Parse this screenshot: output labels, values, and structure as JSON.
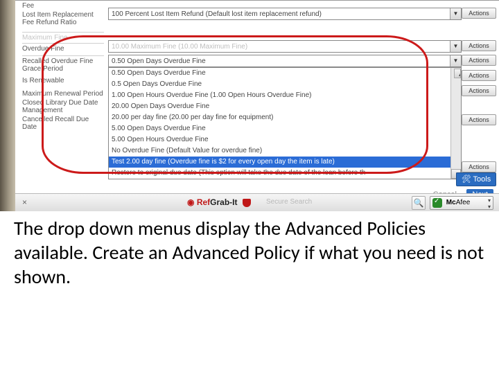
{
  "labels": {
    "fee": "Fee",
    "lost_refund": "Lost Item Replacement Fee Refund Ratio",
    "max_fine": "Maximum Fine",
    "overdue_fine": "Overdue Fine",
    "recalled": "Recalled Overdue Fine Grace Period",
    "is_renewable": "Is Renewable",
    "max_renewal": "Maximum Renewal Period",
    "closed_lib": "Closed Library Due Date Management",
    "cancelled": "Cancelled Recall Due Date"
  },
  "selects": {
    "lost_refund": "100 Percent Lost Item Refund (Default lost item replacement refund)",
    "max_fine": "10.00 Maximum Fine (10.00 Maximum Fine)",
    "overdue_fine": "0.50 Open Days Overdue Fine"
  },
  "dropdown_options": [
    "0.50 Open Days Overdue Fine",
    "0.5 Open Days Overdue Fine",
    "1.00 Open Hours Overdue Fine (1.00 Open Hours Overdue Fine)",
    "20.00 Open Days Overdue Fine",
    "20.00 per day fine (20.00 per day fine for equipment)",
    "5.00 Open Days Overdue Fine",
    "5.00 Open Hours Overdue Fine",
    "No Overdue Fine (Default Value for overdue fine)",
    "Test 2.00 day fine (Overdue fine is $2 for every open day the item is late)",
    "Restore to original due date (This option will take the due date of the loan before th"
  ],
  "dropdown_highlight_index": 8,
  "actions_label": "Actions",
  "actions_count": 7,
  "tools_label": "🛠 Tools",
  "footer_links": {
    "cancel": "Cancel",
    "next": "Next"
  },
  "status": {
    "close": "×",
    "refgrab_red": "Ref",
    "refgrab_black": "Grab-It",
    "secure": "Secure Search",
    "mcafee": "McAfee"
  },
  "caption": "The drop down menus display the Advanced Policies available. Create an Advanced Policy if what you need is not shown."
}
